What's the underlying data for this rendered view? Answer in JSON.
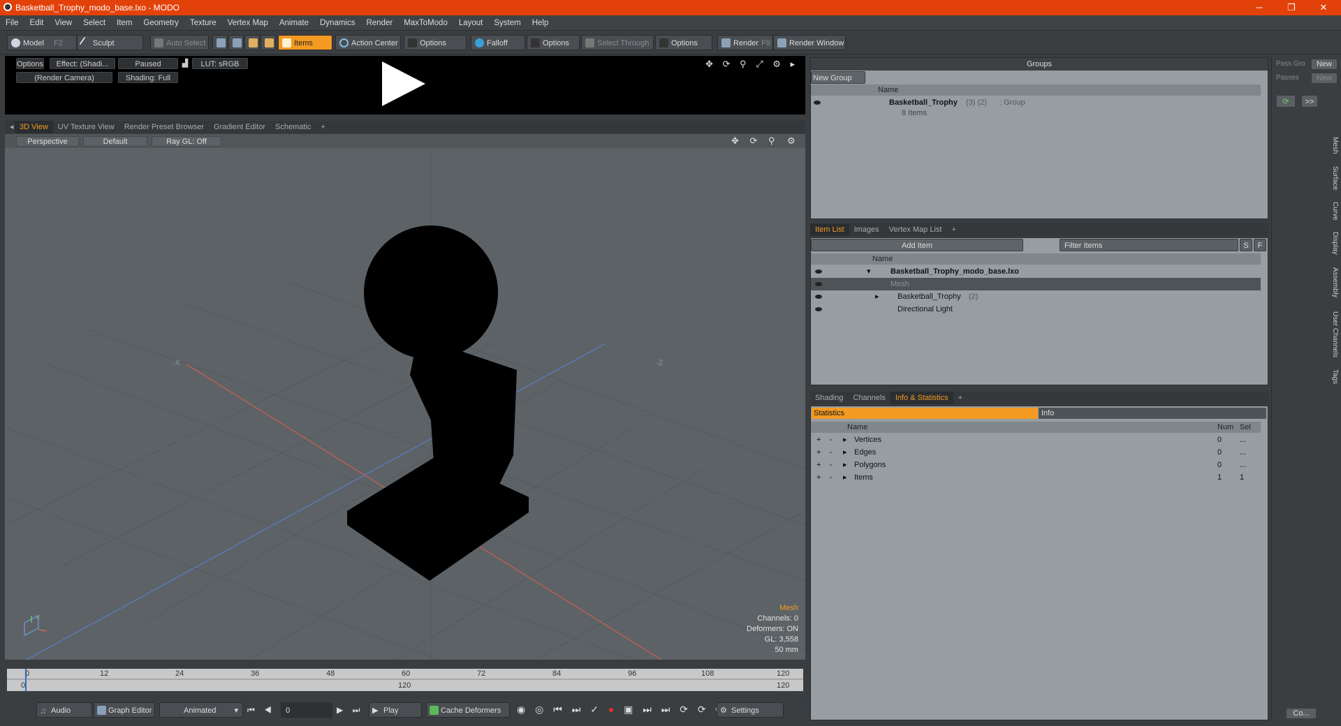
{
  "window": {
    "title": "Basketball_Trophy_modo_base.lxo - MODO",
    "minimize": "─",
    "maximize": "❐",
    "close": "✕"
  },
  "menu": [
    "File",
    "Edit",
    "View",
    "Select",
    "Item",
    "Geometry",
    "Texture",
    "Vertex Map",
    "Animate",
    "Dynamics",
    "Render",
    "MaxToModo",
    "Layout",
    "System",
    "Help"
  ],
  "toolbar": {
    "model": "Model",
    "model_key": "F2",
    "sculpt": "Sculpt",
    "auto_select": "Auto Select",
    "items": "Items",
    "action_center": "Action Center",
    "options1": "Options",
    "falloff": "Falloff",
    "options2": "Options",
    "select_through": "Select Through",
    "options3": "Options",
    "render": "Render",
    "render_key": "F9",
    "render_window": "Render Window"
  },
  "preview": {
    "options": "Options",
    "effect": "Effect: (Shadi...",
    "paused": "Paused",
    "lut": "LUT: sRGB",
    "camera": "(Render Camera)",
    "shading": "Shading: Full",
    "icons": "✥ ⟳ ⚲ ⤢ ⚙ ▸"
  },
  "view_tabs": [
    "3D View",
    "UV Texture View",
    "Render Preset Browser",
    "Gradient Editor",
    "Schematic",
    "+"
  ],
  "viewport": {
    "perspective": "Perspective",
    "default": "Default",
    "raygl": "Ray GL: Off",
    "icons": "✥ ⟳ ⚲",
    "gear": "⚙",
    "axis_x": "-X",
    "axis_z": "-Z",
    "gizmo_y": "Y",
    "info": {
      "type": "Mesh",
      "channels": "Channels: 0",
      "deformers": "Deformers: ON",
      "gl": "GL: 3,558",
      "focal": "50 mm"
    }
  },
  "timeline": {
    "top_labels": [
      "0",
      "12",
      "24",
      "36",
      "48",
      "60",
      "72",
      "84",
      "96",
      "108",
      "120"
    ],
    "bottom_left": "0",
    "bottom_mid": "120",
    "bottom_right": "120"
  },
  "bottombar": {
    "audio": "Audio",
    "graph_editor": "Graph Editor",
    "animated": "Animated",
    "frame": "0",
    "play": "Play",
    "cache": "Cache Deformers",
    "settings": "Settings"
  },
  "groups": {
    "title": "Groups",
    "new_group": "New Group",
    "col_name": "Name",
    "item_name": "Basketball_Trophy",
    "item_counts": "(3) (2)",
    "item_type": ": Group",
    "item_sub": "8 Items"
  },
  "right_strip": {
    "pass_gro": "Pass Gro",
    "passes": "Passes",
    "new1": "New",
    "new2": "New",
    "arrows": ">>",
    "co": "Co...",
    "vtabs": [
      "Mesh",
      "Surface",
      "Curve",
      "Display",
      "Assembly",
      "User Channels",
      "Tags"
    ]
  },
  "item_list": {
    "tabs": [
      "Item List",
      "Images",
      "Vertex Map List",
      "+"
    ],
    "add_item": "Add Item",
    "filter": "Filter Items",
    "s": "S",
    "f": "F",
    "col_name": "Name",
    "rows": [
      {
        "name": "Basketball_Trophy_modo_base.lxo",
        "extra": ""
      },
      {
        "name": "Mesh",
        "extra": ""
      },
      {
        "name": "Basketball_Trophy",
        "extra": "(2)"
      },
      {
        "name": "Directional Light",
        "extra": ""
      }
    ]
  },
  "stats": {
    "tabs": [
      "Shading",
      "Channels",
      "Info & Statistics",
      "+"
    ],
    "statistics": "Statistics",
    "info": "Info",
    "col_name": "Name",
    "col_num": "Num",
    "col_sel": "Sel",
    "rows": [
      {
        "name": "Vertices",
        "num": "0",
        "sel": "..."
      },
      {
        "name": "Edges",
        "num": "0",
        "sel": "..."
      },
      {
        "name": "Polygons",
        "num": "0",
        "sel": "..."
      },
      {
        "name": "Items",
        "num": "1",
        "sel": "1"
      }
    ]
  },
  "colors": {
    "accent": "#f39a23",
    "titlebar": "#e2420a"
  }
}
